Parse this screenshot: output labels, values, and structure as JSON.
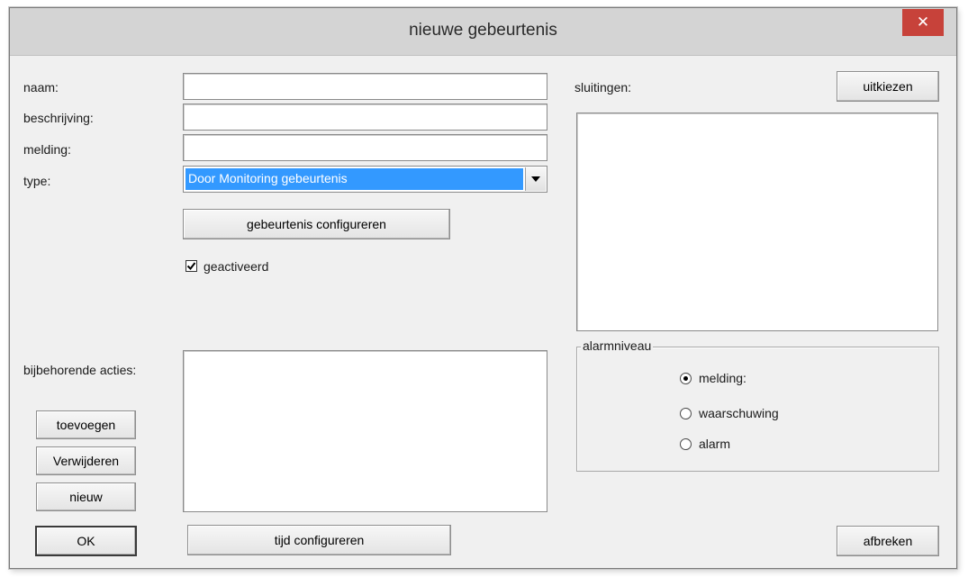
{
  "window": {
    "title": "nieuwe gebeurtenis",
    "close_glyph": "✕"
  },
  "form": {
    "naam_label": "naam:",
    "naam_value": "",
    "beschrijving_label": "beschrijving:",
    "beschrijving_value": "",
    "melding_label": "melding:",
    "melding_value": "",
    "type_label": "type:",
    "type_value": "Door Monitoring gebeurtenis",
    "configure_event_button": "gebeurtenis configureren",
    "activated_label": "geactiveerd",
    "activated_checked": true
  },
  "actions": {
    "label": "bijbehorende acties:",
    "items": [],
    "add_button": "toevoegen",
    "remove_button": "Verwijderen",
    "new_button": "nieuw"
  },
  "locks": {
    "label": "sluitingen:",
    "choose_button": "uitkiezen",
    "items": []
  },
  "alarm_level": {
    "legend": "alarmniveau",
    "options": [
      {
        "label": "melding:",
        "selected": true
      },
      {
        "label": "waarschuwing",
        "selected": false
      },
      {
        "label": "alarm",
        "selected": false
      }
    ]
  },
  "footer": {
    "ok_button": "OK",
    "configure_time_button": "tijd configureren",
    "cancel_button": "afbreken"
  },
  "colors": {
    "close_button": "#c7423a",
    "selection_highlight": "#3399ff",
    "dialog_background": "#f0f0f0"
  }
}
